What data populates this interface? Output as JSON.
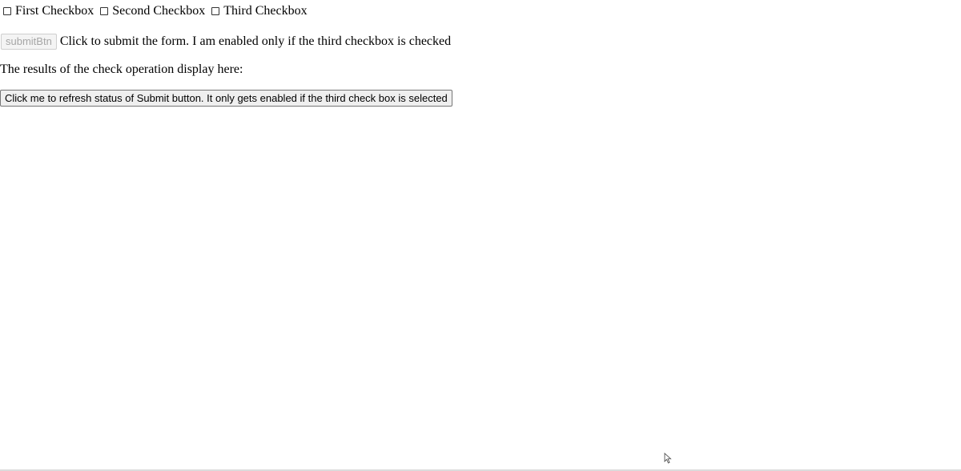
{
  "checkboxes": [
    {
      "label": "First Checkbox",
      "checked": false
    },
    {
      "label": "Second Checkbox",
      "checked": false
    },
    {
      "label": "Third Checkbox",
      "checked": false
    }
  ],
  "submit": {
    "button_label": "submitBtn",
    "description": "Click to submit the form. I am enabled only if the third checkbox is checked",
    "enabled": false
  },
  "results": {
    "label": "The results of the check operation display here:"
  },
  "refresh": {
    "button_label": "Click me to refresh status of Submit button. It only gets enabled if the third check box is selected"
  },
  "cursor": {
    "icon": "arrow-pointer-icon"
  }
}
